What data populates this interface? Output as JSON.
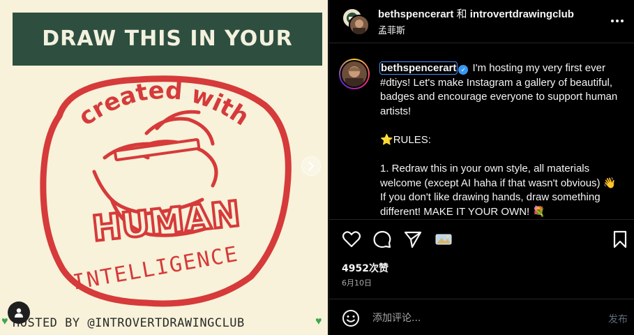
{
  "artwork": {
    "banner_text": "DRAW THIS IN YOUR STYLE",
    "arc_text": "created with",
    "badge_main": "HUMAN",
    "badge_sub": "INTELLIGENCE",
    "footer_text": "HOSTED BY @INTROVERTDRAWINGCLUB",
    "footer_heart": "♥",
    "colors": {
      "background": "#f7f2d9",
      "banner": "#2e4f40",
      "badge": "#d63a3a"
    },
    "user_tag_icon": "person-icon",
    "next_icon": "chevron-right-icon"
  },
  "header": {
    "user1": "bethspencerart",
    "joiner": "和",
    "user2": "introvertdrawingclub",
    "location": "孟菲斯",
    "more_icon": "more-horizontal-icon"
  },
  "caption": {
    "username": "bethspencerart",
    "verified_icon": "verified-badge-icon",
    "first_text": " I'm hosting my very first ever #dtiys! Let's make Instagram a gallery of beautiful, badges and encourage everyone to support human artists!",
    "rules_star": "⭐",
    "rules_heading": "RULES:",
    "rule1": "1. Redraw this in your own style, all materials welcome (except AI haha if that wasn't obvious) 👋 If you don't like drawing hands, draw something different! MAKE IT YOUR OWN! 💐"
  },
  "actions": {
    "icons": [
      "heart-icon",
      "comment-icon",
      "share-icon",
      "media-icon",
      "bookmark-icon"
    ]
  },
  "likes": "4952次赞",
  "date": "6月10日",
  "comment": {
    "placeholder": "添加评论...",
    "post_label": "发布",
    "emoji_icon": "emoji-icon"
  }
}
